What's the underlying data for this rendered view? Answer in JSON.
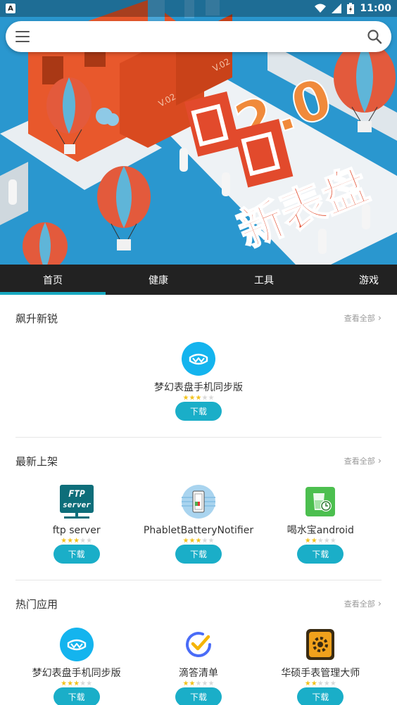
{
  "status_bar": {
    "time": "11:00",
    "notification_glyph": "A"
  },
  "search": {
    "placeholder": ""
  },
  "tabs": [
    {
      "label": "首页",
      "active": true
    },
    {
      "label": "健康",
      "active": false
    },
    {
      "label": "工具",
      "active": false
    },
    {
      "label": "游戏",
      "active": false
    }
  ],
  "banner": {
    "headline": "2.0",
    "subtitle": "新表盘",
    "tag_left": "V.02",
    "tag_right": "V.02"
  },
  "sections": [
    {
      "title": "飙升新锐",
      "view_all": "查看全部",
      "apps": [
        {
          "name": "梦幻表盘手机同步版",
          "icon": "watch-face-sync-icon",
          "rating": 3,
          "button": "下载"
        }
      ]
    },
    {
      "title": "最新上架",
      "view_all": "查看全部",
      "apps": [
        {
          "name": "ftp server",
          "icon": "ftp-server-icon",
          "rating": 3,
          "button": "下载"
        },
        {
          "name": "PhabletBatteryNotifier",
          "icon": "battery-notifier-icon",
          "rating": 3,
          "button": "下载"
        },
        {
          "name": "喝水宝android",
          "icon": "water-reminder-icon",
          "rating": 2,
          "button": "下载"
        }
      ]
    },
    {
      "title": "热门应用",
      "view_all": "查看全部",
      "apps": [
        {
          "name": "梦幻表盘手机同步版",
          "icon": "watch-face-sync-icon",
          "rating": 3,
          "button": "下载"
        },
        {
          "name": "滴答清单",
          "icon": "ticktick-icon",
          "rating": 2,
          "button": "下载"
        },
        {
          "name": "华硕手表管理大师",
          "icon": "asus-watch-manager-icon",
          "rating": 2,
          "button": "下载"
        }
      ]
    }
  ],
  "colors": {
    "accent": "#1aaec8",
    "tab_bar": "#222222",
    "banner_bg": "#2a97cf",
    "star_on": "#f2c21b"
  }
}
